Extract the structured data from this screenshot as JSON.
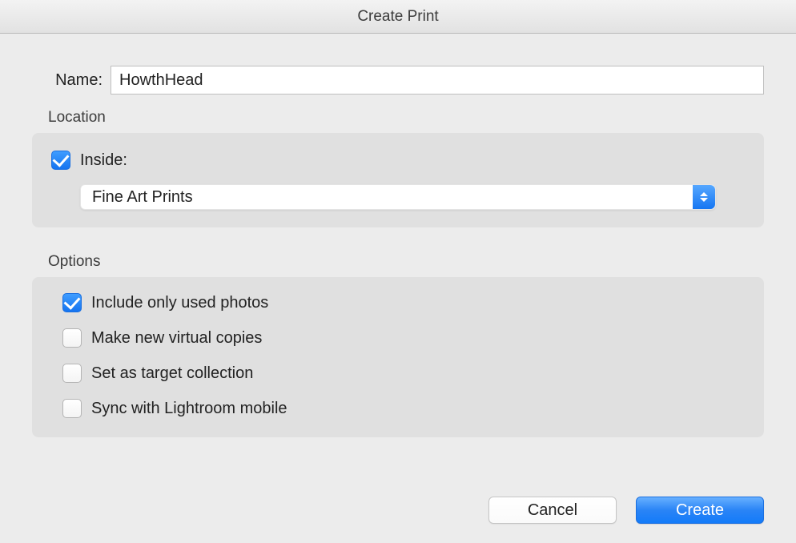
{
  "window": {
    "title": "Create Print"
  },
  "name": {
    "label": "Name:",
    "value": "HowthHead"
  },
  "location": {
    "group_title": "Location",
    "inside_checked": true,
    "inside_label": "Inside:",
    "selected_collection": "Fine Art Prints"
  },
  "options": {
    "group_title": "Options",
    "items": [
      {
        "label": "Include only used photos",
        "checked": true
      },
      {
        "label": "Make new virtual copies",
        "checked": false
      },
      {
        "label": "Set as target collection",
        "checked": false
      },
      {
        "label": "Sync with Lightroom mobile",
        "checked": false
      }
    ]
  },
  "buttons": {
    "cancel": "Cancel",
    "create": "Create"
  }
}
